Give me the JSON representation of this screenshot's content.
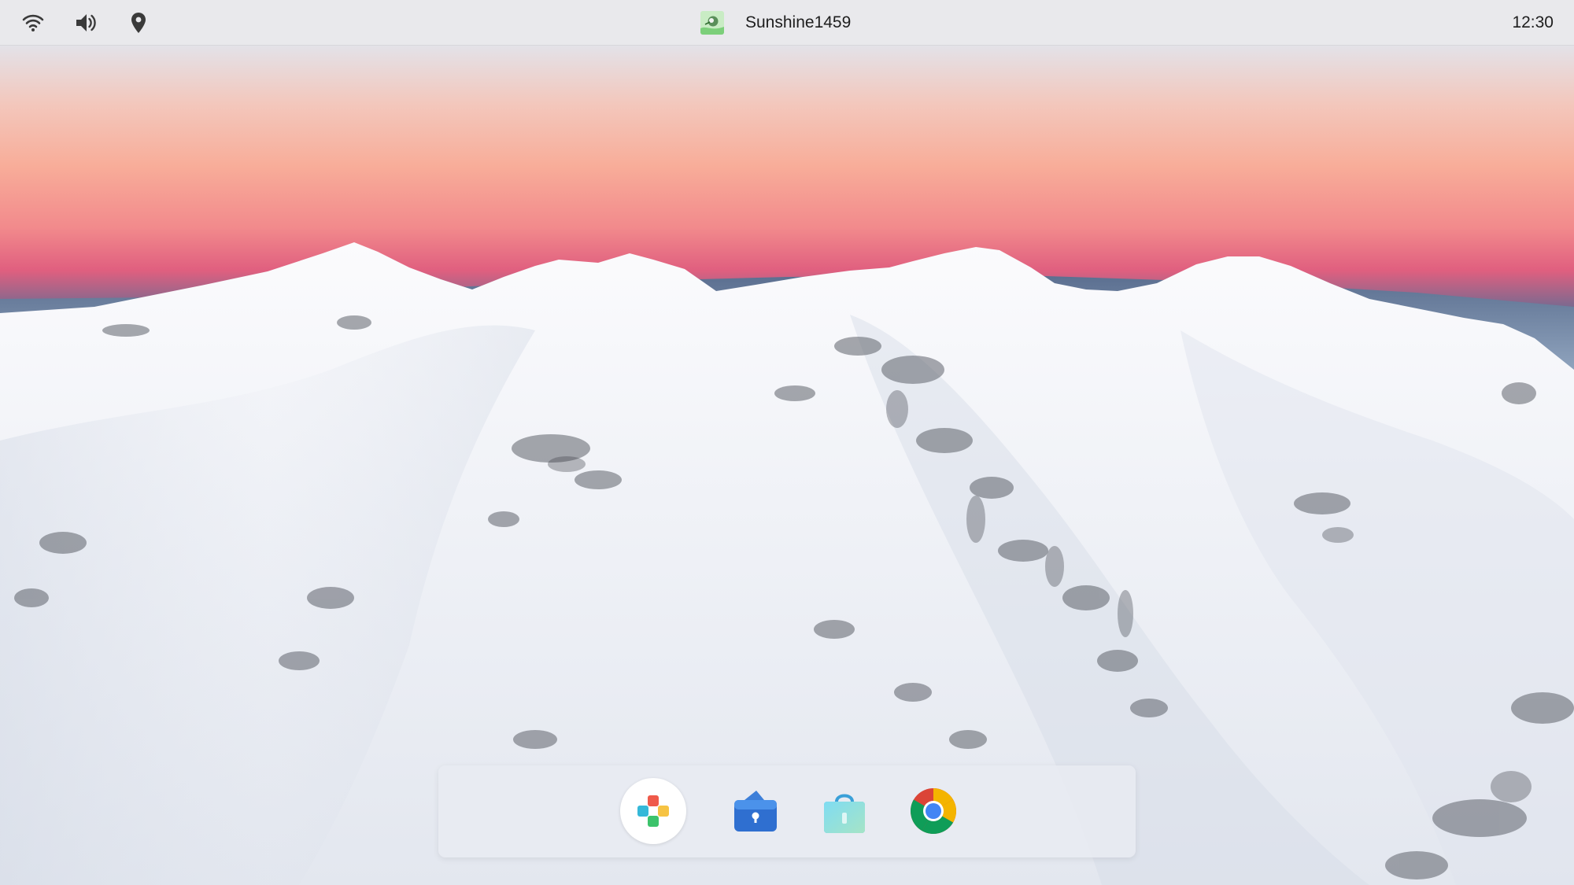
{
  "statusbar": {
    "left_icons": [
      "wifi-icon",
      "volume-icon",
      "location-pin-icon"
    ],
    "username": "Sunshine1459",
    "clock": "12:30"
  },
  "dock": {
    "apps": [
      {
        "icon": "app-launcher-icon"
      },
      {
        "icon": "files-app-icon"
      },
      {
        "icon": "app-store-icon"
      },
      {
        "icon": "chrome-browser-icon"
      }
    ]
  },
  "colors": {
    "statusbar_bg": "#e9e9ec",
    "dock_bg": "#e8ebf1",
    "sky_top": "#e6e0e6",
    "sky_glow": "#f6a69a",
    "sky_horizon": "#e4607e",
    "ridge_blue": "#4f6f93",
    "snow": "#f3f5f9"
  }
}
